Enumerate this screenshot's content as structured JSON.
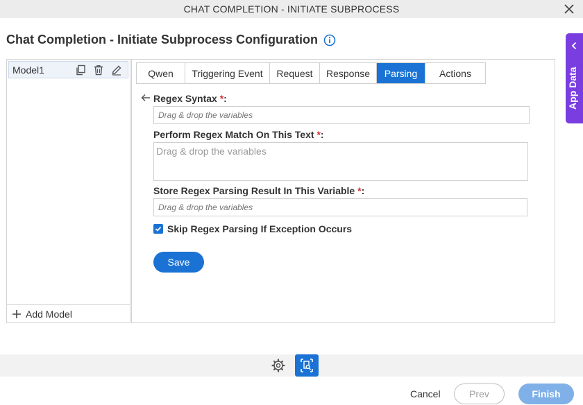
{
  "window": {
    "title": "CHAT COMPLETION - INITIATE SUBPROCESS"
  },
  "page": {
    "heading": "Chat Completion - Initiate Subprocess Configuration"
  },
  "models": {
    "items": [
      {
        "label": "Model1"
      }
    ],
    "add_label": "Add Model"
  },
  "tabs": [
    {
      "label": "Qwen"
    },
    {
      "label": "Triggering Event"
    },
    {
      "label": "Request"
    },
    {
      "label": "Response"
    },
    {
      "label": "Parsing",
      "active": true
    },
    {
      "label": "Actions"
    }
  ],
  "form": {
    "regex_syntax": {
      "label": "Regex Syntax",
      "required": "*",
      "placeholder": "Drag & drop the variables"
    },
    "match_text": {
      "label": "Perform Regex Match On This Text",
      "required": "*",
      "placeholder": "Drag & drop the variables"
    },
    "store_result": {
      "label": "Store Regex Parsing Result In This Variable",
      "required": "*",
      "placeholder": "Drag & drop the variables"
    },
    "skip_exception": {
      "label": "Skip Regex Parsing If Exception Occurs",
      "checked": true
    },
    "colon": ":",
    "save_label": "Save"
  },
  "side_tab": {
    "label": "App Data"
  },
  "footer": {
    "cancel_label": "Cancel",
    "prev_label": "Prev",
    "finish_label": "Finish"
  },
  "colors": {
    "accent": "#1a73d4",
    "app_data": "#7a3ee0",
    "finish_disabled": "#7fb0e8",
    "required": "#d32f2f"
  }
}
